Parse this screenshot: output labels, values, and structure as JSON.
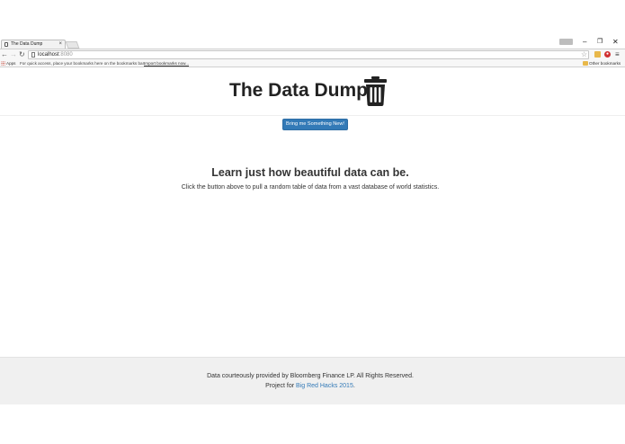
{
  "browser": {
    "tab_title": "The Data Dump",
    "tab_close": "×",
    "url_host": "localhost",
    "url_port": ":8080",
    "bookmarks": {
      "apps_label": "Apps",
      "hint": "For quick access, place your bookmarks here on the bookmarks bar.",
      "import_link": "Import bookmarks now...",
      "other": "Other bookmarks"
    },
    "icons": {
      "back": "arrow-left",
      "forward": "arrow-right",
      "reload": "reload",
      "star": "star",
      "menu": "hamburger-menu",
      "minimize": "minimize",
      "restore": "restore",
      "close": "close"
    }
  },
  "page": {
    "title": "The Data Dump",
    "action_button": "Bring me Something New!",
    "lead": "Learn just how beautiful data can be.",
    "subtext": "Click the button above to pull a random table of data from a vast database of world statistics.",
    "footer": {
      "line1": "Data courteously provided by Bloomberg Finance LP. All Rights Reserved.",
      "line2_prefix": "Project for ",
      "line2_link": "Big Red Hacks 2015",
      "line2_suffix": "."
    }
  },
  "colors": {
    "accent": "#337ab7",
    "footer_bg": "#f0f0f0",
    "title": "#222222"
  }
}
